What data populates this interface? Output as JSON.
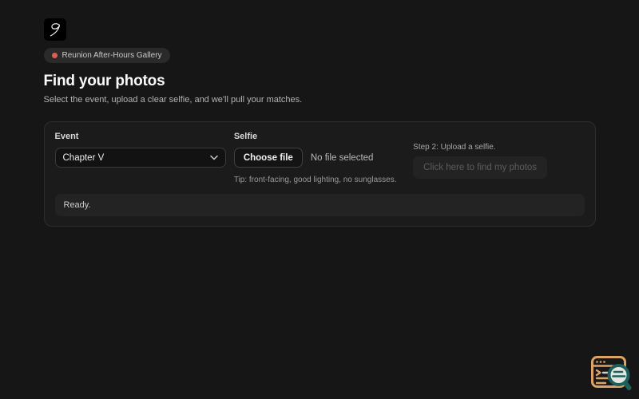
{
  "header": {
    "badge_label": "Reunion After-Hours Gallery",
    "title": "Find your photos",
    "subtitle": "Select the event, upload a clear selfie, and we'll pull your matches."
  },
  "form": {
    "event_label": "Event",
    "event_selected": "Chapter V",
    "selfie_label": "Selfie",
    "choose_file_label": "Choose file",
    "file_status": "No file selected",
    "tip": "Tip: front-facing, good lighting, no sunglasses.",
    "step_hint": "Step 2: Upload a selfie.",
    "find_button_label": "Click here to find my photos",
    "status_text": "Ready."
  },
  "icons": {
    "logo": "brand-swoosh",
    "select_chevron": "chevron-down",
    "overlay": "window-magnifier"
  },
  "colors": {
    "page_bg": "#161616",
    "card_bg": "#1b1b1b",
    "card_border": "#2d2d2d",
    "accent_dot": "#dd5f4f",
    "overlay_window": "#dda366",
    "overlay_glass": "#1c5f5c"
  }
}
